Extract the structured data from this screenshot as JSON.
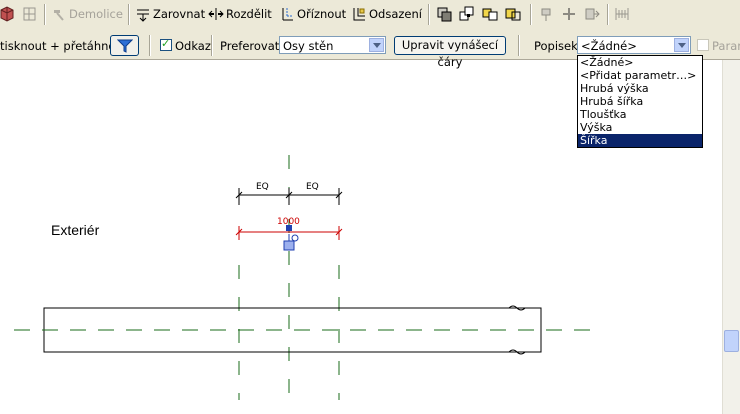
{
  "toolbar": {
    "demolice_label": "Demolice",
    "zarovnat_label": "Zarovnat",
    "rozdelit_label": "Rozdělit",
    "oriznout_label": "Oříznout",
    "odsazeni_label": "Odsazení"
  },
  "options": {
    "filter_label": "tisknout + přetáhnout",
    "odkaz_label": "Odkaz",
    "odkaz_checked": true,
    "preferovat_label": "Preferovat:",
    "preferovat_value": "Osy stěn",
    "upravit_button": "Upravit vynášecí čáry",
    "popisek_label": "Popisek:",
    "popisek_value": "<Žádné>",
    "param_label": "Param"
  },
  "dropdown": {
    "items": [
      "<Žádné>",
      "<Přidat parametr…>",
      "Hrubá výška",
      "Hrubá šířka",
      "Tloušťka",
      "Výška",
      "Šířka"
    ],
    "selected_index": 6
  },
  "drawing": {
    "room_label": "Exteriér",
    "eq_left": "EQ",
    "eq_right": "EQ",
    "dimension_value": "1000",
    "accent_color": "#cc0000"
  }
}
